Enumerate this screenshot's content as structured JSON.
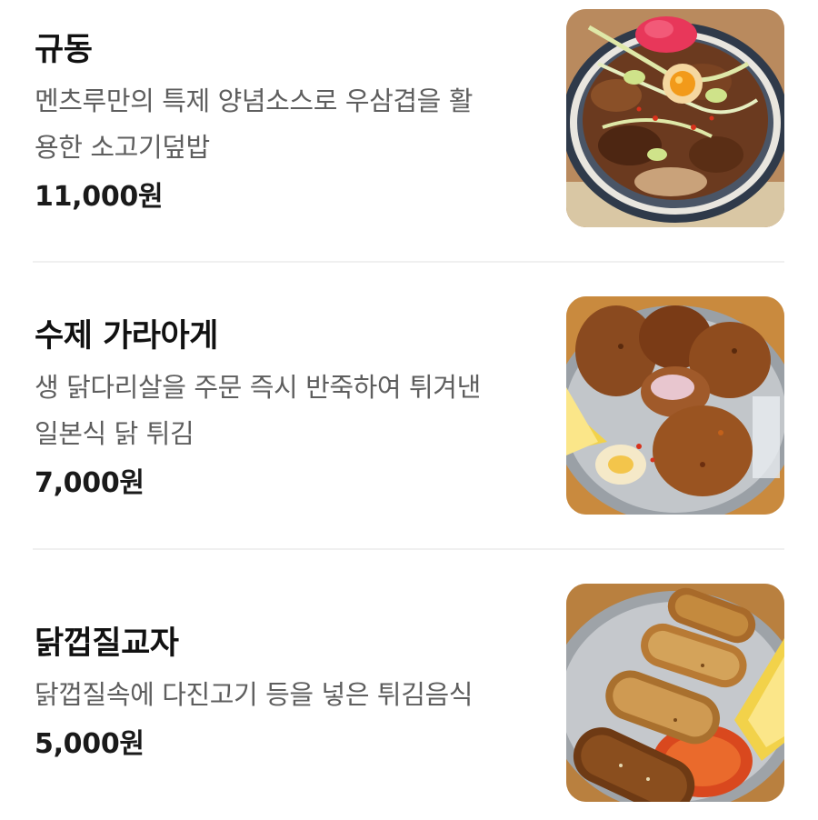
{
  "menu": {
    "items": [
      {
        "name": "규동",
        "description_line1": "멘츠루만의 특제 양념소스로 우삼겹을 활",
        "description_line2": "용한 소고기덮밥",
        "price": "11,000원",
        "image_icon": "beef-bowl-photo"
      },
      {
        "name": "수제 가라아게",
        "description_line1": "생 닭다리살을 주문 즉시 반죽하여 튀겨낸",
        "description_line2": "일본식 닭 튀김",
        "price": "7,000원",
        "image_icon": "fried-chicken-photo"
      },
      {
        "name": "닭껍질교자",
        "description_line1": "닭껍질속에 다진고기 등을 넣은 튀김음식",
        "price": "5,000원",
        "image_icon": "chicken-skin-gyoza-photo"
      }
    ]
  }
}
